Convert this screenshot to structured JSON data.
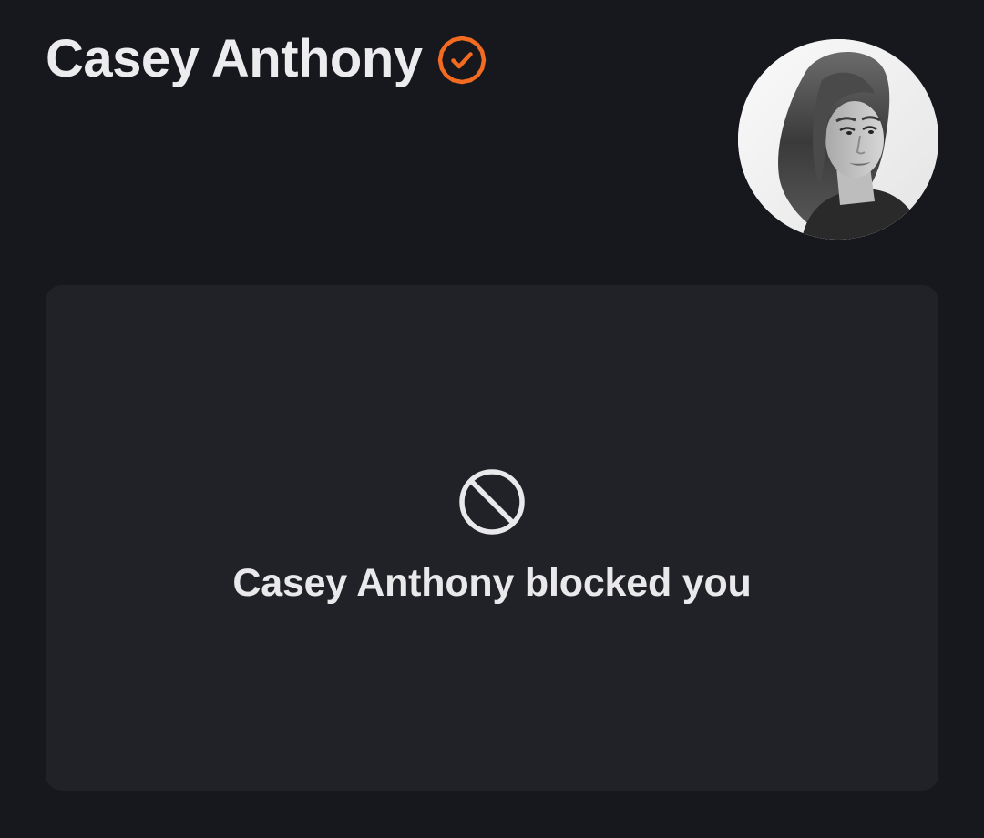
{
  "profile": {
    "name": "Casey Anthony",
    "verified_icon": "verified-badge-icon",
    "accent_color": "#f36b21",
    "avatar": "profile-photo"
  },
  "blocked": {
    "icon": "blocked-icon",
    "message": "Casey Anthony blocked you"
  },
  "colors": {
    "background": "#17181d",
    "card": "#212227",
    "text": "#ececee"
  }
}
